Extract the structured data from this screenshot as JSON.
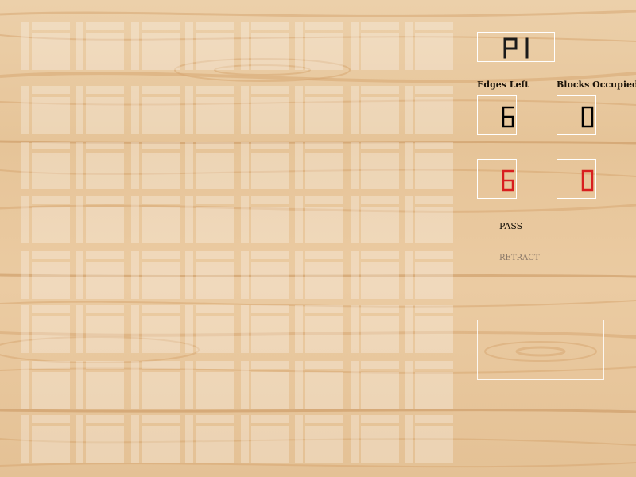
{
  "game": {
    "player_indicator": "P1",
    "labels": {
      "edges_left": "Edges Left",
      "blocks_occupied": "Blocks Occupied"
    },
    "player1": {
      "edges_left": "6",
      "blocks_occupied": "0",
      "digit_color": "#000000"
    },
    "player2": {
      "edges_left": "6",
      "blocks_occupied": "0",
      "digit_color": "#d81e1e"
    },
    "buttons": {
      "pass": "PASS",
      "retract": "RETRACT"
    },
    "board": {
      "rows": 8,
      "cols": 8
    }
  },
  "colors": {
    "wood_base": "#eac9a0",
    "wood_grain": "#d9ab76",
    "panel_border": "#ffffff"
  }
}
